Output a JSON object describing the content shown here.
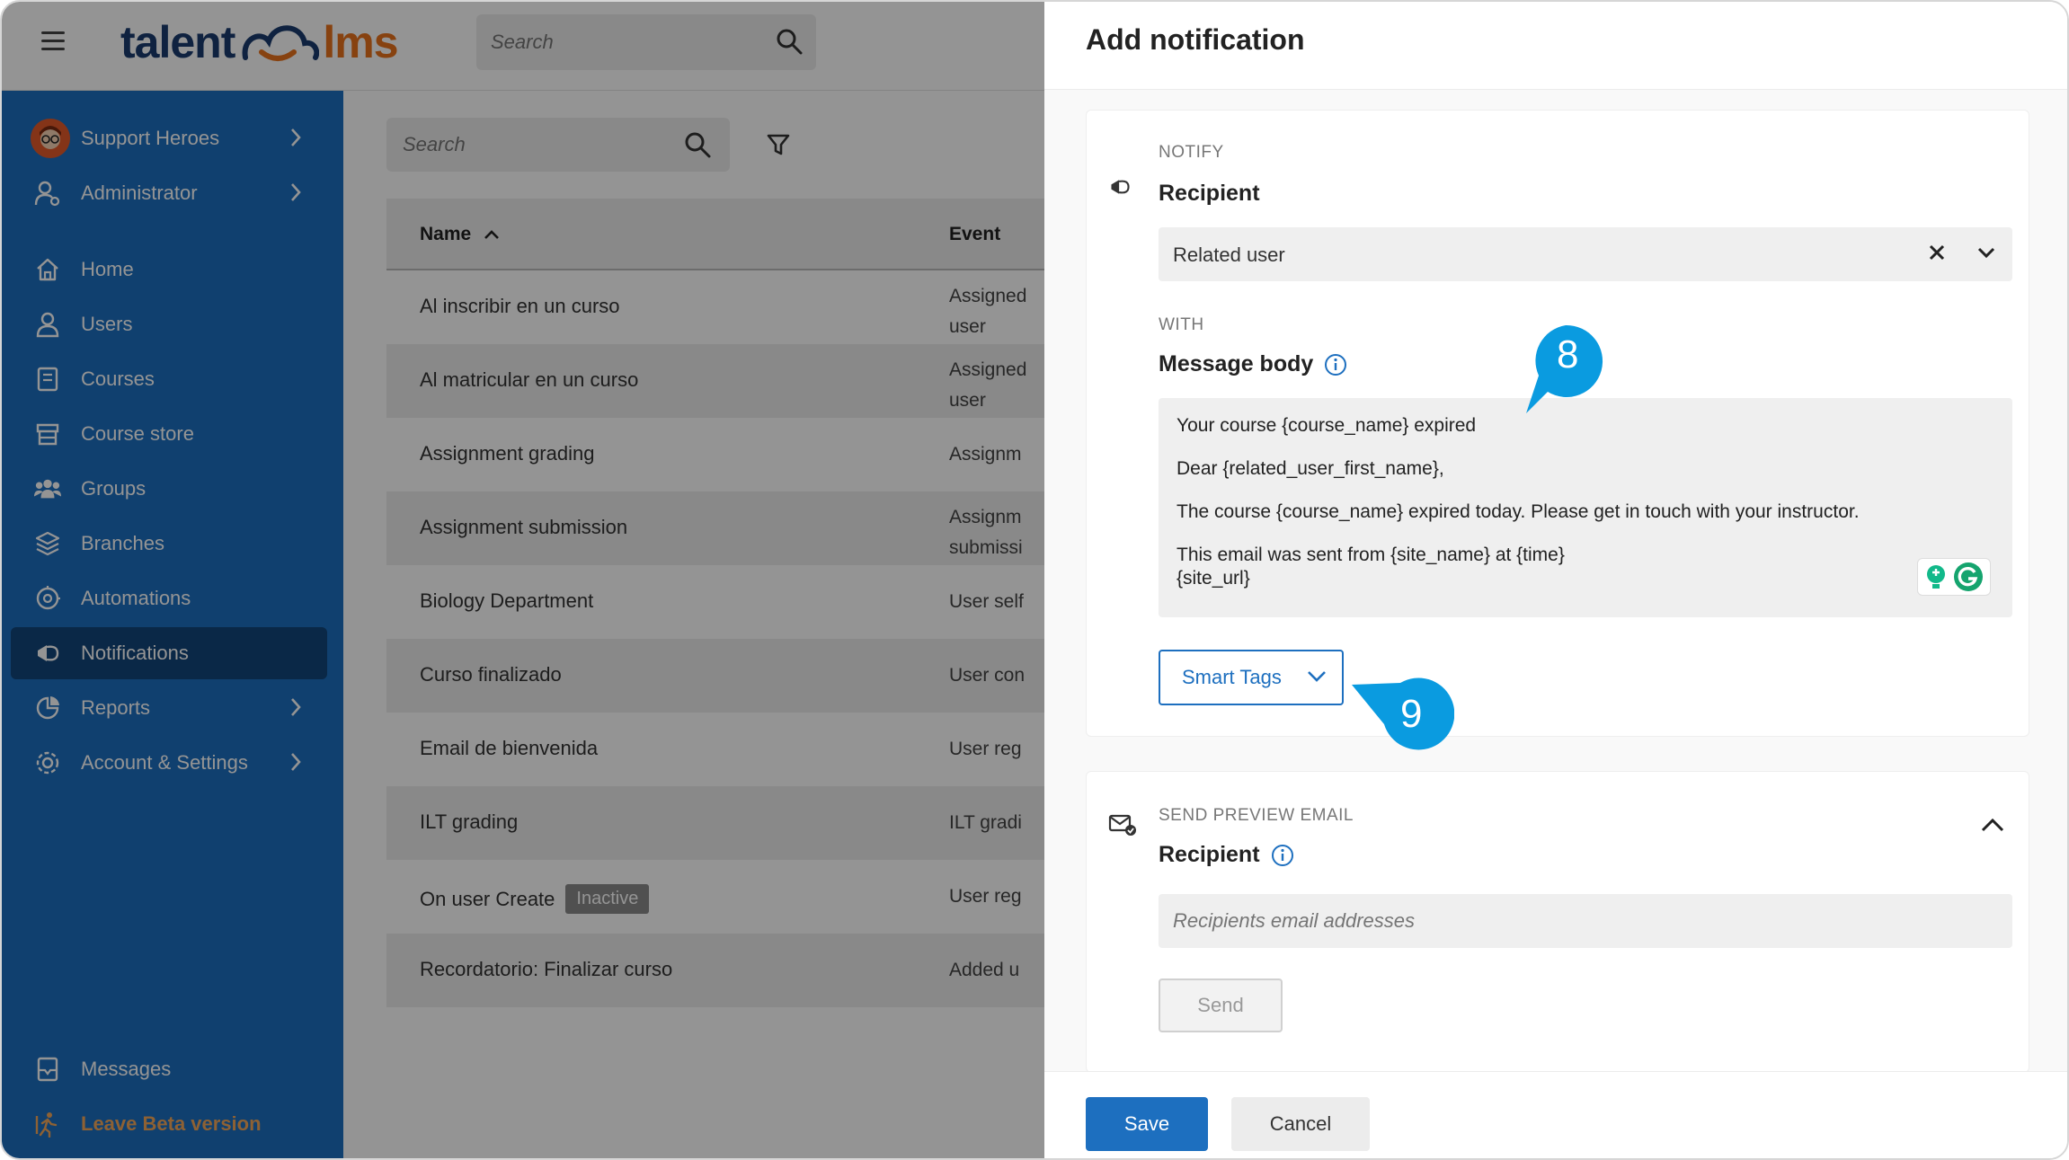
{
  "app": {
    "logo_left": "talent",
    "logo_right": "lms",
    "search_placeholder": "Search"
  },
  "sidebar": {
    "account": "Support Heroes",
    "role": "Administrator",
    "items": [
      {
        "label": "Home",
        "icon": "home-icon"
      },
      {
        "label": "Users",
        "icon": "user-icon"
      },
      {
        "label": "Courses",
        "icon": "courses-icon"
      },
      {
        "label": "Course store",
        "icon": "store-icon"
      },
      {
        "label": "Groups",
        "icon": "groups-icon"
      },
      {
        "label": "Branches",
        "icon": "branches-icon"
      },
      {
        "label": "Automations",
        "icon": "automations-icon"
      },
      {
        "label": "Notifications",
        "icon": "notifications-icon",
        "active": true
      },
      {
        "label": "Reports",
        "icon": "reports-icon"
      },
      {
        "label": "Account & Settings",
        "icon": "settings-icon"
      }
    ],
    "messages": "Messages",
    "leave_beta": "Leave Beta version",
    "colors": {
      "background": "#1d6fbf",
      "active": "#12457a",
      "beta": "#f3a85a"
    }
  },
  "list": {
    "search_placeholder": "Search",
    "columns": [
      "Name",
      "Event"
    ],
    "rows": [
      {
        "name": "Al inscribir en un curso",
        "event": "Assigned user"
      },
      {
        "name": "Al matricular en un curso",
        "event": "Assigned user"
      },
      {
        "name": "Assignment grading",
        "event": "Assignm"
      },
      {
        "name": "Assignment submission",
        "event": "Assignm submissi"
      },
      {
        "name": "Biology Department",
        "event": "User self"
      },
      {
        "name": "Curso finalizado",
        "event": "User con"
      },
      {
        "name": "Email de bienvenida",
        "event": "User reg"
      },
      {
        "name": "ILT grading",
        "event": "ILT gradi"
      },
      {
        "name": "On user Create",
        "badge": "Inactive",
        "event": "User reg"
      },
      {
        "name": "Recordatorio: Finalizar curso",
        "event": "Added u"
      }
    ]
  },
  "drawer": {
    "title": "Add notification",
    "notify": {
      "label": "NOTIFY",
      "title": "Recipient",
      "value": "Related user"
    },
    "with": {
      "label": "WITH",
      "title": "Message body",
      "body": [
        "Your course {course_name} expired",
        "Dear {related_user_first_name},",
        "The course {course_name} expired today. Please get in touch with your instructor.",
        "This email was sent from {site_name} at {time}",
        "{site_url}"
      ],
      "smart_tags": "Smart Tags"
    },
    "preview": {
      "label": "SEND PREVIEW EMAIL",
      "title": "Recipient",
      "placeholder": "Recipients email addresses",
      "send": "Send"
    },
    "save": "Save",
    "cancel": "Cancel"
  },
  "callouts": [
    "8",
    "9"
  ],
  "accent_color": "#1d6fbf",
  "callout_color": "#0a9be0"
}
